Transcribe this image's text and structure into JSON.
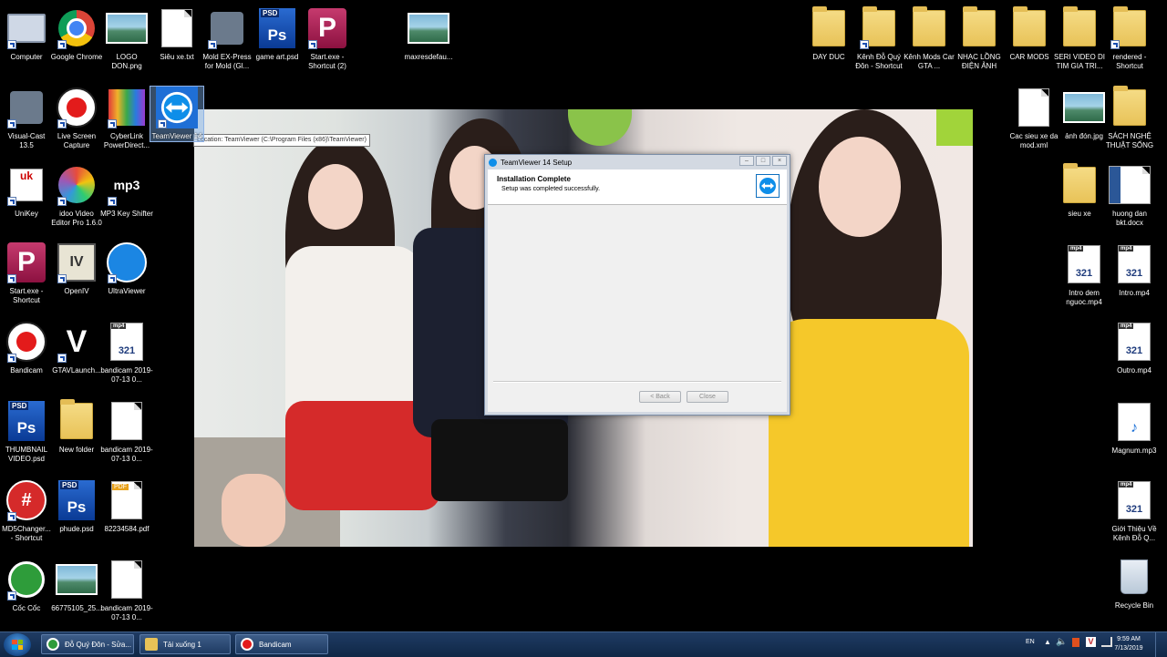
{
  "desktop": {
    "left_icons": [
      {
        "label": "Computer",
        "icon": "computer-icon"
      },
      {
        "label": "Google Chrome",
        "icon": "chrome-icon"
      },
      {
        "label": "LOGO DON.png",
        "icon": "image-icon"
      },
      {
        "label": "Siêu xe.txt",
        "icon": "text-file-icon"
      },
      {
        "label": "Mold EX-Press for Mold (Gl...",
        "icon": "app-icon"
      },
      {
        "label": "game art.psd",
        "icon": "psd-icon"
      },
      {
        "label": "Start.exe - Shortcut (2)",
        "icon": "p-app-icon"
      },
      {
        "label": "maxresdefau...",
        "icon": "image-icon"
      },
      {
        "label": "Visual-Cast 13.5",
        "icon": "app-icon"
      },
      {
        "label": "Live Screen Capture",
        "icon": "record-icon"
      },
      {
        "label": "CyberLink PowerDirect...",
        "icon": "cyberlink-icon"
      },
      {
        "label": "TeamViewer 14",
        "icon": "teamviewer-icon"
      },
      {
        "label": "UniKey",
        "icon": "unikey-icon"
      },
      {
        "label": "idoo Video Editor Pro 1.6.0",
        "icon": "idoo-icon"
      },
      {
        "label": "MP3 Key Shifter",
        "icon": "mp3-key-icon"
      },
      {
        "label": "Start.exe - Shortcut",
        "icon": "p-app-icon"
      },
      {
        "label": "OpenIV",
        "icon": "openiv-icon"
      },
      {
        "label": "UltraViewer",
        "icon": "ultraviewer-icon"
      },
      {
        "label": "Bandicam",
        "icon": "bandicam-icon"
      },
      {
        "label": "GTAVLaunch...",
        "icon": "gta-icon"
      },
      {
        "label": "bandicam 2019-07-13 0...",
        "icon": "video-file-icon"
      },
      {
        "label": "THUMBNAIL VIDEO.psd",
        "icon": "psd-icon"
      },
      {
        "label": "New folder",
        "icon": "folder-icon"
      },
      {
        "label": "bandicam 2019-07-13 0...",
        "icon": "file-icon"
      },
      {
        "label": "MD5Changer... - Shortcut",
        "icon": "md5-icon"
      },
      {
        "label": "phude.psd",
        "icon": "psd-icon"
      },
      {
        "label": "82234584.pdf",
        "icon": "pdf-icon"
      },
      {
        "label": "Cốc Cốc",
        "icon": "coccoc-icon"
      },
      {
        "label": "66775105_25...",
        "icon": "image-icon"
      },
      {
        "label": "bandicam 2019-07-13 0...",
        "icon": "file-icon"
      }
    ],
    "right_icons": [
      {
        "label": "DAY DUC",
        "icon": "folder-icon"
      },
      {
        "label": "Kênh Đỗ Quý Đôn - Shortcut",
        "icon": "folder-icon"
      },
      {
        "label": "Kênh Mods Car GTA ...",
        "icon": "folder-icon"
      },
      {
        "label": "NHẠC LỒNG ĐIỆN ẢNH",
        "icon": "folder-icon"
      },
      {
        "label": "CAR MODS",
        "icon": "folder-icon"
      },
      {
        "label": "SERI VIDEO DI TIM GIA TRI...",
        "icon": "folder-icon"
      },
      {
        "label": "rendered - Shortcut",
        "icon": "folder-icon"
      },
      {
        "label": "Cac sieu xe da mod.xml",
        "icon": "file-icon"
      },
      {
        "label": "ảnh đón.jpg",
        "icon": "image-icon"
      },
      {
        "label": "SÁCH NGHỆ THUẬT SỐNG",
        "icon": "folder-icon"
      },
      {
        "label": "sieu xe",
        "icon": "folder-icon"
      },
      {
        "label": "huong dan bkt.docx",
        "icon": "word-icon"
      },
      {
        "label": "Intro dem nguoc.mp4",
        "icon": "video-file-icon"
      },
      {
        "label": "Intro.mp4",
        "icon": "video-file-icon"
      },
      {
        "label": "Outro.mp4",
        "icon": "video-file-icon"
      },
      {
        "label": "Magnum.mp3",
        "icon": "audio-file-icon"
      },
      {
        "label": "Giới Thiệu Về Kênh Đỗ Q...",
        "icon": "video-file-icon"
      },
      {
        "label": "Recycle Bin",
        "icon": "recycle-bin-icon"
      }
    ],
    "tooltip": "Location: TeamViewer (C:\\Program Files (x86)\\TeamViewer)"
  },
  "dialog": {
    "title": "TeamViewer 14 Setup",
    "heading": "Installation Complete",
    "subheading": "Setup was completed successfully.",
    "back_label": "< Back",
    "close_label": "Close"
  },
  "taskbar": {
    "items": [
      {
        "label": "Đỗ Quý Đôn - Sửa...",
        "icon": "coccoc-icon"
      },
      {
        "label": "Tải xuống 1",
        "icon": "folder-icon"
      },
      {
        "label": "Bandicam",
        "icon": "bandicam-icon"
      }
    ],
    "lang": "EN",
    "time": "9:59 AM",
    "date": "7/13/2019"
  },
  "colors": {
    "taskbar": "#0f2746",
    "accent": "#0e8ee9",
    "folder": "#e8c257"
  }
}
